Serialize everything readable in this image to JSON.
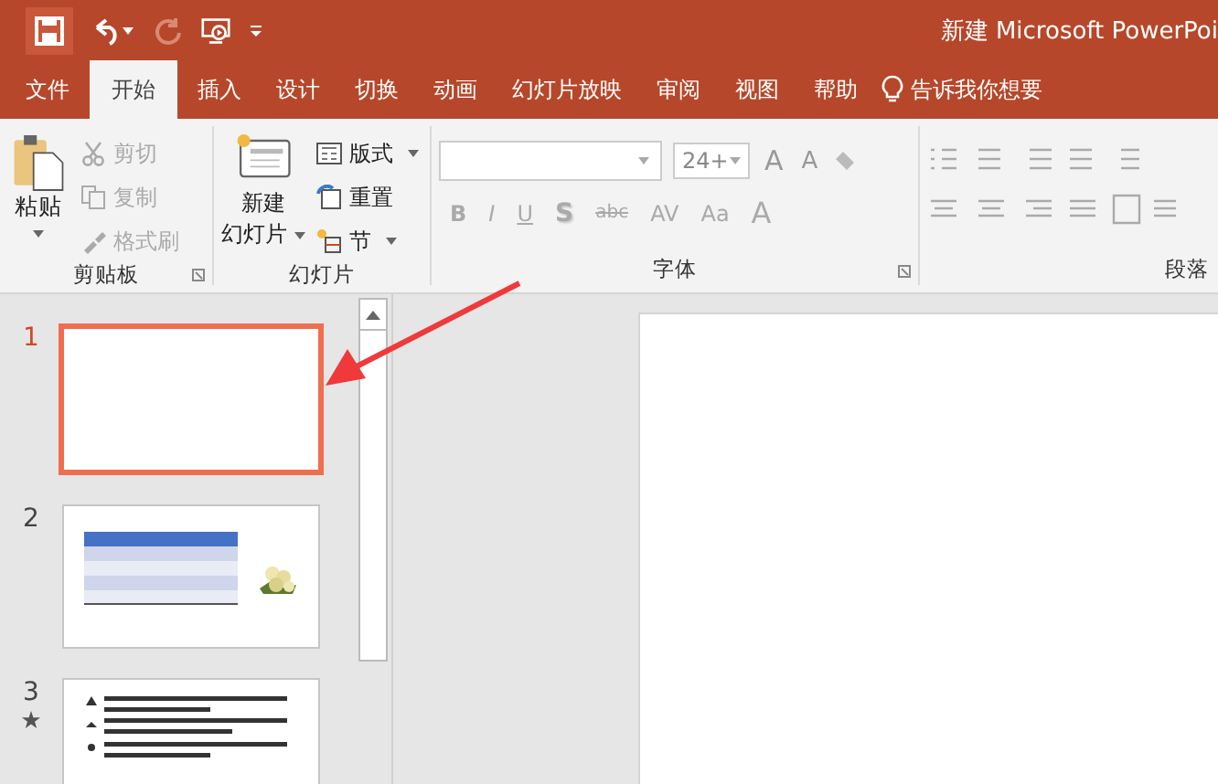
{
  "title_bar": {
    "title": "新建 Microsoft PowerPoi"
  },
  "tabs": [
    {
      "label": "文件",
      "selected": false
    },
    {
      "label": "开始",
      "selected": true
    },
    {
      "label": "插入",
      "selected": false
    },
    {
      "label": "设计",
      "selected": false
    },
    {
      "label": "切换",
      "selected": false
    },
    {
      "label": "动画",
      "selected": false
    },
    {
      "label": "幻灯片放映",
      "selected": false
    },
    {
      "label": "审阅",
      "selected": false
    },
    {
      "label": "视图",
      "selected": false
    },
    {
      "label": "帮助",
      "selected": false
    }
  ],
  "tell_me": "告诉我你想要",
  "clipboard": {
    "paste": "粘贴",
    "items": [
      {
        "label": "剪切",
        "kind": "cut",
        "disabled": true
      },
      {
        "label": "复制",
        "kind": "copy",
        "disabled": true
      },
      {
        "label": "格式刷",
        "kind": "painter",
        "disabled": true
      }
    ],
    "group_label": "剪贴板"
  },
  "slides_group": {
    "new_slide": [
      "新建",
      "幻灯片"
    ],
    "items": [
      {
        "label": "版式",
        "kind": "layout"
      },
      {
        "label": "重置",
        "kind": "reset"
      },
      {
        "label": "节",
        "kind": "section"
      }
    ],
    "group_label": "幻灯片"
  },
  "font": {
    "size": "24+",
    "row1": [
      "A",
      "A"
    ],
    "row2": [
      {
        "label": "B",
        "kind": "bold"
      },
      {
        "label": "I",
        "kind": "italic"
      },
      {
        "label": "U",
        "kind": "underline"
      },
      {
        "label": "S",
        "kind": "shadow"
      },
      {
        "label": "abc",
        "kind": "strike"
      },
      {
        "label": "AV",
        "kind": "spacing"
      },
      {
        "label": "Aa",
        "kind": "case"
      },
      {
        "label": "A",
        "kind": "color"
      }
    ],
    "group_label": "字体"
  },
  "paragraph": {
    "group_label": "段落"
  },
  "slides": [
    {
      "number": "1",
      "selected": true,
      "kind": "blank",
      "animated": false
    },
    {
      "number": "2",
      "selected": false,
      "kind": "table",
      "animated": false
    },
    {
      "number": "3",
      "selected": false,
      "kind": "text",
      "animated": true
    }
  ]
}
